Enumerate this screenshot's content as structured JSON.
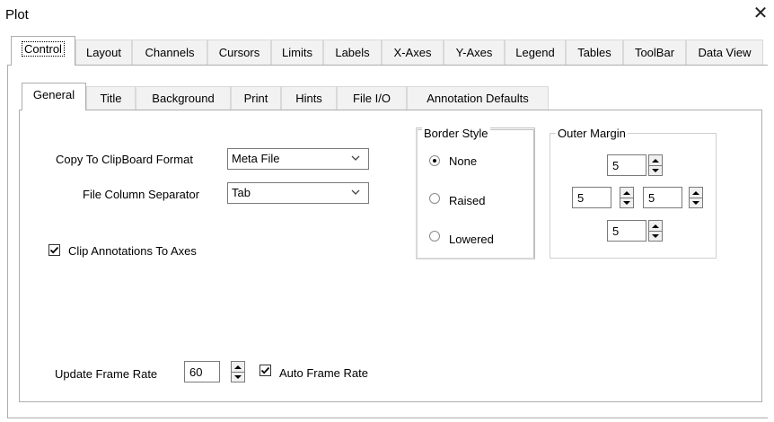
{
  "window": {
    "title": "Plot",
    "close_glyph": "✕"
  },
  "outer_tabs": [
    "Control",
    "Layout",
    "Channels",
    "Cursors",
    "Limits",
    "Labels",
    "X-Axes",
    "Y-Axes",
    "Legend",
    "Tables",
    "ToolBar",
    "Data View"
  ],
  "outer_active": "Control",
  "inner_tabs": [
    "General",
    "Title",
    "Background",
    "Print",
    "Hints",
    "File I/O",
    "Annotation Defaults"
  ],
  "inner_active": "General",
  "general": {
    "clipboard_label": "Copy To ClipBoard Format",
    "clipboard_value": "Meta File",
    "separator_label": "File Column Separator",
    "separator_value": "Tab",
    "clip_annotations_label": "Clip Annotations To Axes",
    "clip_annotations_checked": true,
    "frame_rate_label": "Update Frame Rate",
    "frame_rate_value": "60",
    "auto_frame_rate_label": "Auto Frame Rate",
    "auto_frame_rate_checked": true
  },
  "border_style": {
    "title": "Border Style",
    "options": [
      "None",
      "Raised",
      "Lowered"
    ],
    "selected": "None"
  },
  "outer_margin": {
    "title": "Outer Margin",
    "top": "5",
    "left": "5",
    "right": "5",
    "bottom": "5"
  }
}
